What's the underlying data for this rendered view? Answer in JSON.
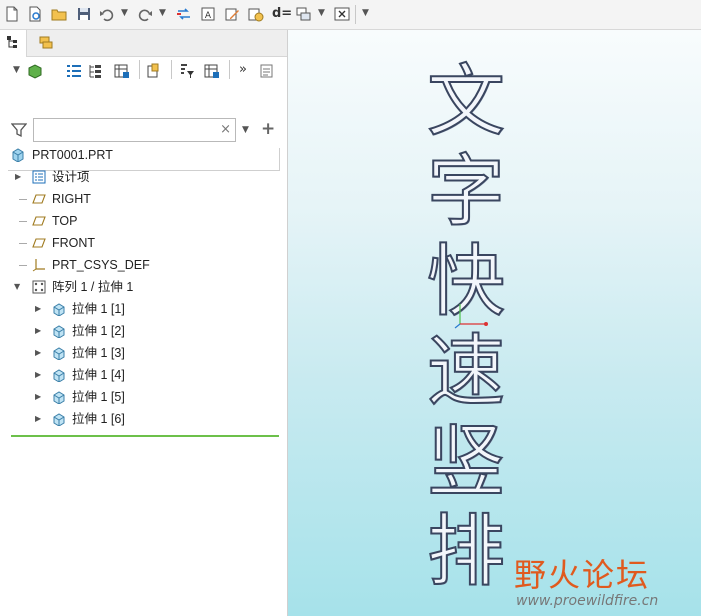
{
  "toolbar": {
    "icons": [
      "new-file-icon",
      "open-file-icon",
      "folder-icon",
      "save-icon",
      "undo-icon",
      "redo-icon",
      "regenerate-icon",
      "annotation-icon",
      "edit-icon",
      "settings-icon",
      "dimension-icon",
      "windows-icon",
      "close-window-icon",
      "more-icon"
    ],
    "dimension_label": "d="
  },
  "model_tree": {
    "tabs": [
      "model-tree-tab",
      "layer-tree-tab"
    ],
    "filter_placeholder": "",
    "root": "PRT0001.PRT",
    "items": [
      {
        "label": "设计项",
        "icon": "design-items-icon",
        "level": 1,
        "expand": "collapsed"
      },
      {
        "label": "RIGHT",
        "icon": "datum-plane-icon",
        "level": 1,
        "expand": "none"
      },
      {
        "label": "TOP",
        "icon": "datum-plane-icon",
        "level": 1,
        "expand": "none"
      },
      {
        "label": "FRONT",
        "icon": "datum-plane-icon",
        "level": 1,
        "expand": "none"
      },
      {
        "label": "PRT_CSYS_DEF",
        "icon": "coordinate-system-icon",
        "level": 1,
        "expand": "none"
      },
      {
        "label": "阵列 1 / 拉伸 1",
        "icon": "pattern-icon",
        "level": 1,
        "expand": "expanded"
      },
      {
        "label": "拉伸 1 [1]",
        "icon": "extrude-icon",
        "level": 2,
        "expand": "collapsed"
      },
      {
        "label": "拉伸 1 [2]",
        "icon": "extrude-icon",
        "level": 2,
        "expand": "collapsed"
      },
      {
        "label": "拉伸 1 [3]",
        "icon": "extrude-icon",
        "level": 2,
        "expand": "collapsed"
      },
      {
        "label": "拉伸 1 [4]",
        "icon": "extrude-icon",
        "level": 2,
        "expand": "collapsed"
      },
      {
        "label": "拉伸 1 [5]",
        "icon": "extrude-icon",
        "level": 2,
        "expand": "collapsed"
      },
      {
        "label": "拉伸 1 [6]",
        "icon": "extrude-icon",
        "level": 2,
        "expand": "collapsed"
      }
    ]
  },
  "viewport": {
    "characters": [
      "文",
      "字",
      "快",
      "速",
      "竖",
      "排"
    ],
    "watermark_brand": "野火论坛",
    "watermark_url": "www.proewildfire.cn"
  },
  "colors": {
    "accent": "#1d6fb8",
    "insert_line": "#6cc04a",
    "viewport_bottom": "#a6e2ea"
  }
}
